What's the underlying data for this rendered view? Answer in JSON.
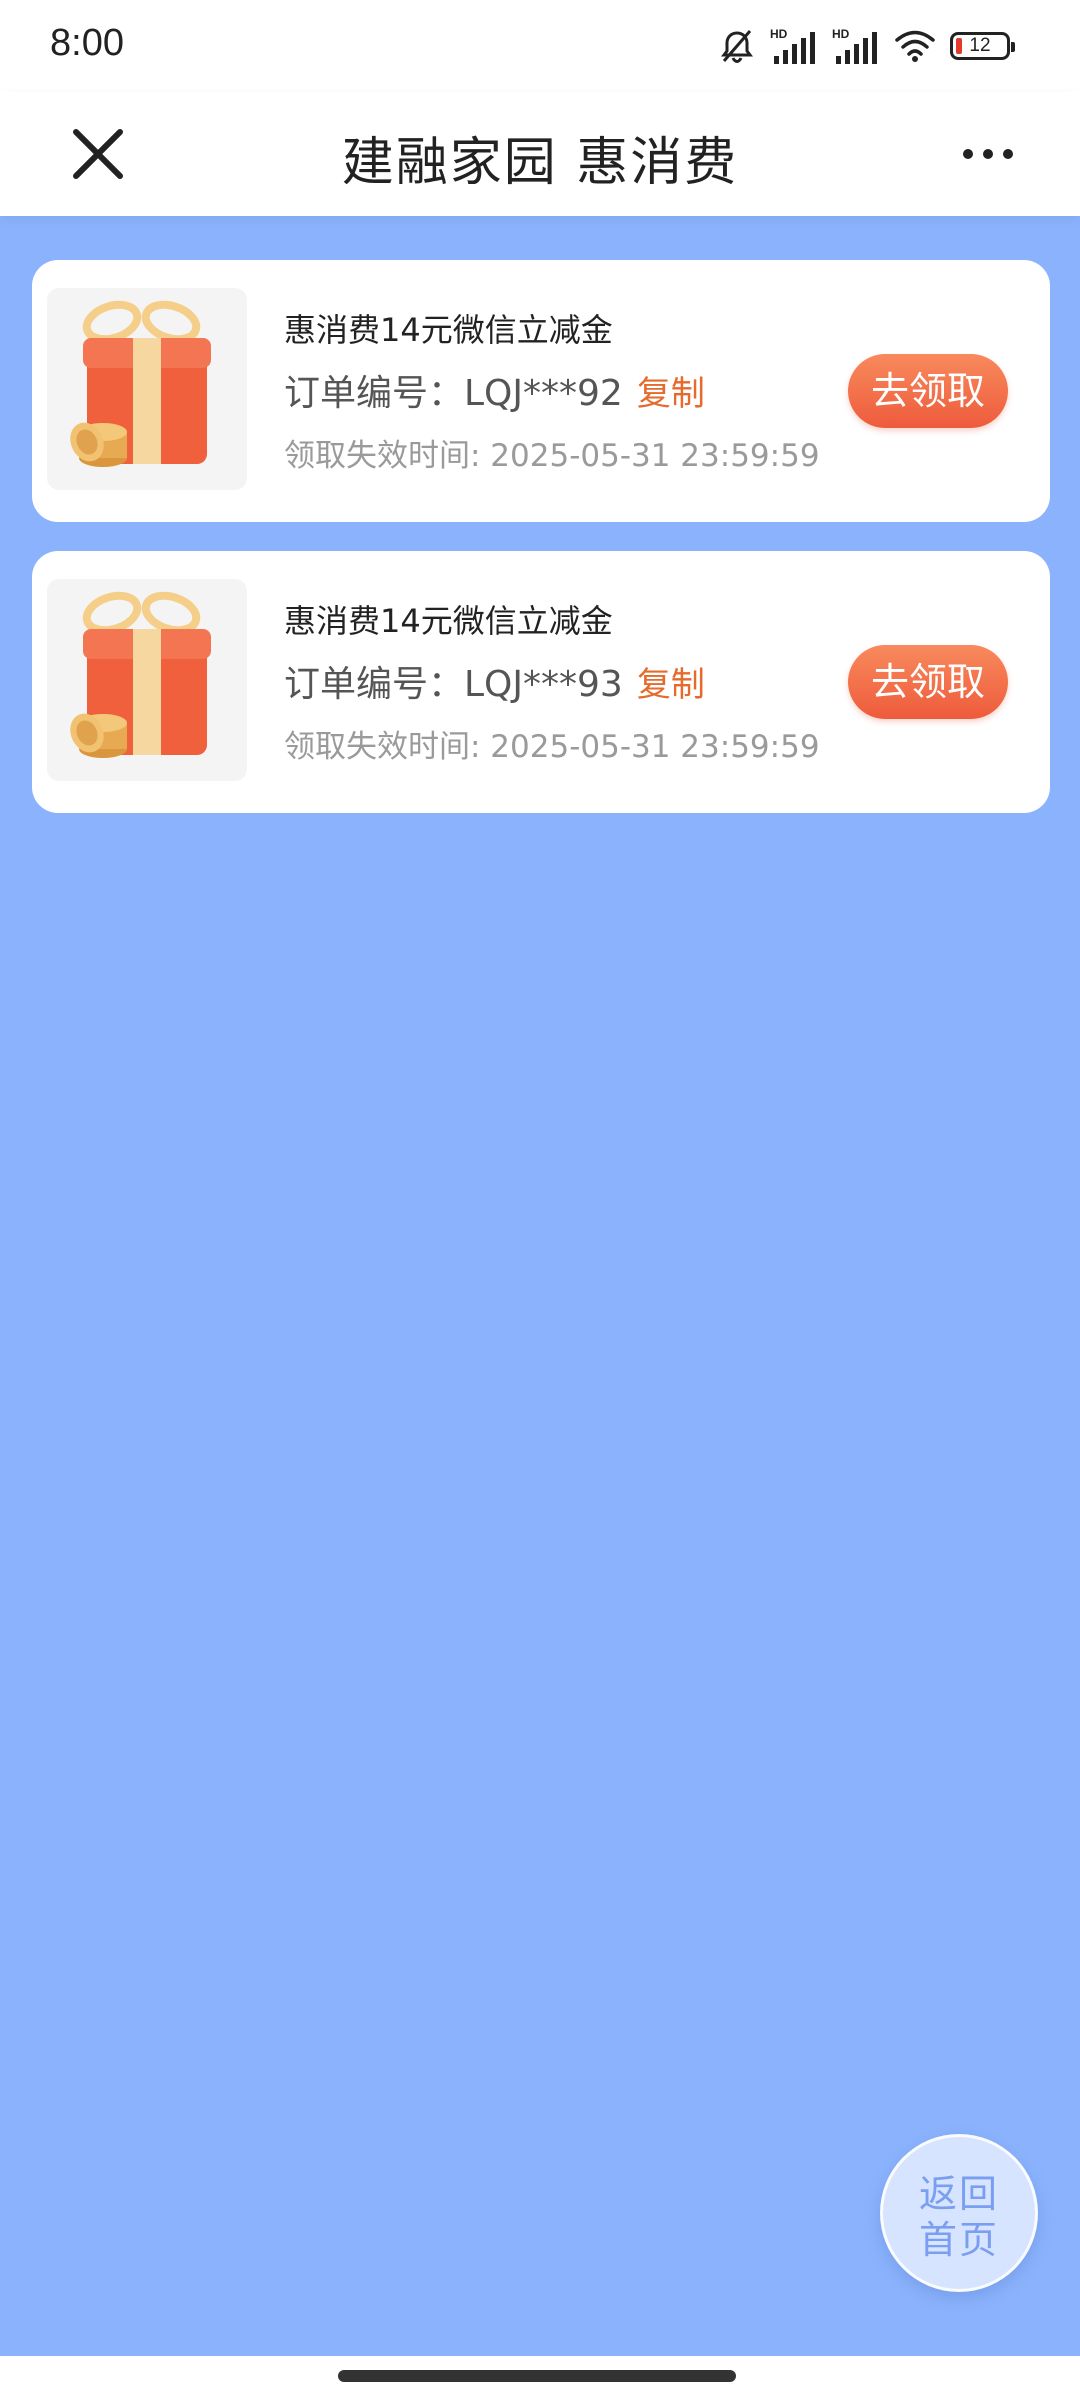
{
  "status_bar": {
    "time": "8:00",
    "battery": "12",
    "icons": [
      "bell-off-icon",
      "hd-signal-icon",
      "hd-signal-icon",
      "wifi-icon",
      "battery-icon"
    ]
  },
  "header": {
    "title": "建融家园 惠消费",
    "left_icon": "close-icon",
    "right_icon": "more-icon"
  },
  "vouchers": [
    {
      "name": "惠消费14元微信立减金",
      "order_label": "订单编号：LQJ***92",
      "copy_label": "复制",
      "expire_label": "领取失效时间: 2025-05-31 23:59:59",
      "claim_label": "去领取",
      "image": "gift-box-icon"
    },
    {
      "name": "惠消费14元微信立减金",
      "order_label": "订单编号：LQJ***93",
      "copy_label": "复制",
      "expire_label": "领取失效时间: 2025-05-31 23:59:59",
      "claim_label": "去领取",
      "image": "gift-box-icon"
    }
  ],
  "float_button": {
    "label": "返回首页"
  },
  "colors": {
    "page_background": "#8bb3fd",
    "accent_orange": "#ee5b3c",
    "copy_orange": "#e66a2c"
  }
}
